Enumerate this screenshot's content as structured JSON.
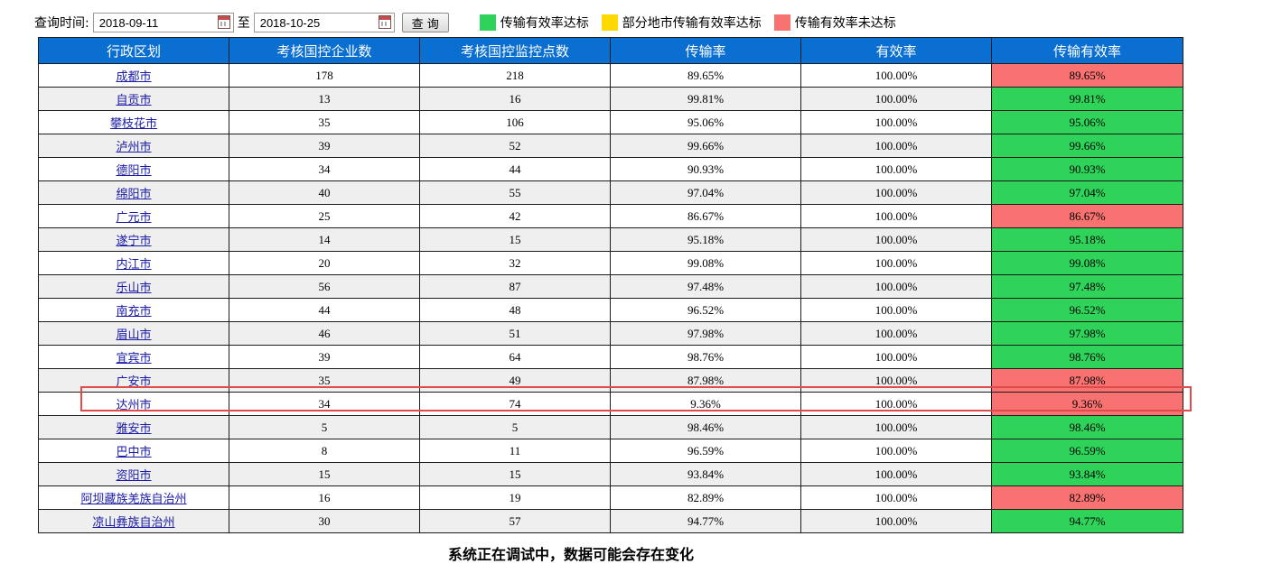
{
  "toolbar": {
    "query_label": "查询时间:",
    "start_date": "2018-09-11",
    "to_label": "至",
    "end_date": "2018-10-25",
    "query_button": "查 询"
  },
  "legend": [
    {
      "label": "传输有效率达标",
      "color": "#2fd35a"
    },
    {
      "label": "部分地市传输有效率达标",
      "color": "#ffd800"
    },
    {
      "label": "传输有效率未达标",
      "color": "#f87272"
    }
  ],
  "table": {
    "headers": [
      "行政区划",
      "考核国控企业数",
      "考核国控监控点数",
      "传输率",
      "有效率",
      "传输有效率"
    ],
    "rows": [
      {
        "region": "成都市",
        "enterprises": "178",
        "points": "218",
        "transfer": "89.65%",
        "valid": "100.00%",
        "effective": "89.65%",
        "status": "bad"
      },
      {
        "region": "自贡市",
        "enterprises": "13",
        "points": "16",
        "transfer": "99.81%",
        "valid": "100.00%",
        "effective": "99.81%",
        "status": "ok"
      },
      {
        "region": "攀枝花市",
        "enterprises": "35",
        "points": "106",
        "transfer": "95.06%",
        "valid": "100.00%",
        "effective": "95.06%",
        "status": "ok"
      },
      {
        "region": "泸州市",
        "enterprises": "39",
        "points": "52",
        "transfer": "99.66%",
        "valid": "100.00%",
        "effective": "99.66%",
        "status": "ok"
      },
      {
        "region": "德阳市",
        "enterprises": "34",
        "points": "44",
        "transfer": "90.93%",
        "valid": "100.00%",
        "effective": "90.93%",
        "status": "ok"
      },
      {
        "region": "绵阳市",
        "enterprises": "40",
        "points": "55",
        "transfer": "97.04%",
        "valid": "100.00%",
        "effective": "97.04%",
        "status": "ok"
      },
      {
        "region": "广元市",
        "enterprises": "25",
        "points": "42",
        "transfer": "86.67%",
        "valid": "100.00%",
        "effective": "86.67%",
        "status": "bad"
      },
      {
        "region": "遂宁市",
        "enterprises": "14",
        "points": "15",
        "transfer": "95.18%",
        "valid": "100.00%",
        "effective": "95.18%",
        "status": "ok"
      },
      {
        "region": "内江市",
        "enterprises": "20",
        "points": "32",
        "transfer": "99.08%",
        "valid": "100.00%",
        "effective": "99.08%",
        "status": "ok"
      },
      {
        "region": "乐山市",
        "enterprises": "56",
        "points": "87",
        "transfer": "97.48%",
        "valid": "100.00%",
        "effective": "97.48%",
        "status": "ok"
      },
      {
        "region": "南充市",
        "enterprises": "44",
        "points": "48",
        "transfer": "96.52%",
        "valid": "100.00%",
        "effective": "96.52%",
        "status": "ok"
      },
      {
        "region": "眉山市",
        "enterprises": "46",
        "points": "51",
        "transfer": "97.98%",
        "valid": "100.00%",
        "effective": "97.98%",
        "status": "ok"
      },
      {
        "region": "宜宾市",
        "enterprises": "39",
        "points": "64",
        "transfer": "98.76%",
        "valid": "100.00%",
        "effective": "98.76%",
        "status": "ok"
      },
      {
        "region": "广安市",
        "enterprises": "35",
        "points": "49",
        "transfer": "87.98%",
        "valid": "100.00%",
        "effective": "87.98%",
        "status": "bad"
      },
      {
        "region": "达州市",
        "enterprises": "34",
        "points": "74",
        "transfer": "9.36%",
        "valid": "100.00%",
        "effective": "9.36%",
        "status": "bad"
      },
      {
        "region": "雅安市",
        "enterprises": "5",
        "points": "5",
        "transfer": "98.46%",
        "valid": "100.00%",
        "effective": "98.46%",
        "status": "ok"
      },
      {
        "region": "巴中市",
        "enterprises": "8",
        "points": "11",
        "transfer": "96.59%",
        "valid": "100.00%",
        "effective": "96.59%",
        "status": "ok"
      },
      {
        "region": "资阳市",
        "enterprises": "15",
        "points": "15",
        "transfer": "93.84%",
        "valid": "100.00%",
        "effective": "93.84%",
        "status": "ok"
      },
      {
        "region": "阿坝藏族羌族自治州",
        "enterprises": "16",
        "points": "19",
        "transfer": "82.89%",
        "valid": "100.00%",
        "effective": "82.89%",
        "status": "bad"
      },
      {
        "region": "凉山彝族自治州",
        "enterprises": "30",
        "points": "57",
        "transfer": "94.77%",
        "valid": "100.00%",
        "effective": "94.77%",
        "status": "ok"
      }
    ]
  },
  "footer_text": "系统正在调试中，数据可能会存在变化"
}
